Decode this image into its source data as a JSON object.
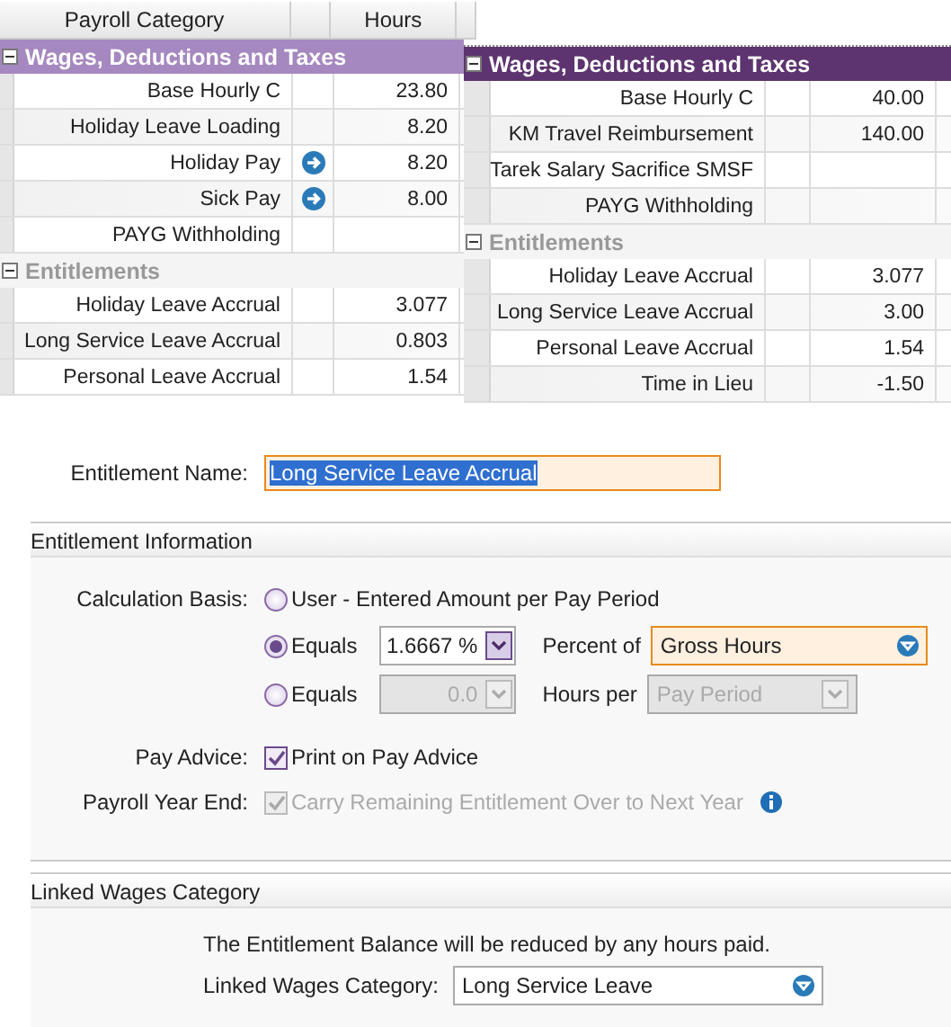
{
  "grids": [
    {
      "columns": [
        "Payroll Category",
        "",
        "Hours",
        ""
      ],
      "groups": [
        {
          "title": "Wages, Deductions and Taxes",
          "kind": "light",
          "expanded": true,
          "rows": [
            {
              "category": "Base Hourly C",
              "linked": false,
              "hours": "23.80"
            },
            {
              "category": "Holiday Leave Loading",
              "linked": false,
              "hours": "8.20"
            },
            {
              "category": "Holiday Pay",
              "linked": true,
              "hours": "8.20"
            },
            {
              "category": "Sick Pay",
              "linked": true,
              "hours": "8.00"
            },
            {
              "category": "PAYG Withholding",
              "linked": false,
              "hours": ""
            }
          ]
        },
        {
          "title": "Entitlements",
          "kind": "plain",
          "expanded": true,
          "rows": [
            {
              "category": "Holiday Leave Accrual",
              "linked": false,
              "hours": "3.077"
            },
            {
              "category": "Long Service Leave Accrual",
              "linked": false,
              "hours": "0.803"
            },
            {
              "category": "Personal Leave Accrual",
              "linked": false,
              "hours": "1.54"
            }
          ]
        }
      ]
    },
    {
      "groups": [
        {
          "title": "Wages, Deductions and Taxes",
          "kind": "dark",
          "expanded": true,
          "rows": [
            {
              "category": "Base Hourly C",
              "linked": false,
              "hours": "40.00"
            },
            {
              "category": "KM Travel Reimbursement",
              "linked": false,
              "hours": "140.00"
            },
            {
              "category": "Tarek Salary Sacrifice SMSF",
              "linked": false,
              "hours": ""
            },
            {
              "category": "PAYG Withholding",
              "linked": false,
              "hours": ""
            }
          ]
        },
        {
          "title": "Entitlements",
          "kind": "plain",
          "expanded": true,
          "rows": [
            {
              "category": "Holiday Leave Accrual",
              "linked": false,
              "hours": "3.077"
            },
            {
              "category": "Long Service Leave Accrual",
              "linked": false,
              "hours": "3.00"
            },
            {
              "category": "Personal Leave Accrual",
              "linked": false,
              "hours": "1.54"
            },
            {
              "category": "Time in Lieu",
              "linked": false,
              "hours": "-1.50"
            }
          ]
        }
      ]
    }
  ],
  "entitlement_name": {
    "label": "Entitlement Name:",
    "value": "Long Service Leave Accrual"
  },
  "entitlement_information": {
    "title": "Entitlement Information",
    "calculation_label": "Calculation Basis:",
    "options": [
      {
        "kind": "user",
        "label": "User - Entered Amount per Pay Period",
        "selected": false
      },
      {
        "kind": "percent",
        "label": "Equals",
        "selected": true,
        "amount": "1.6667 %",
        "unit_label": "Percent of",
        "basis": "Gross Hours",
        "disabled": false
      },
      {
        "kind": "hours",
        "label": "Equals",
        "selected": false,
        "amount": "0.0",
        "unit_label": "Hours per",
        "basis": "Pay Period",
        "disabled": true
      }
    ],
    "pay_advice": {
      "label": "Pay Advice:",
      "text": "Print on Pay Advice",
      "checked": true,
      "disabled": false
    },
    "year_end": {
      "label": "Payroll Year End:",
      "text": "Carry Remaining Entitlement Over to Next Year",
      "checked": true,
      "disabled": true
    }
  },
  "linked_wages": {
    "title": "Linked Wages Category",
    "note": "The Entitlement Balance will be reduced by any hours paid.",
    "label": "Linked Wages Category:",
    "value": "Long Service Leave"
  }
}
